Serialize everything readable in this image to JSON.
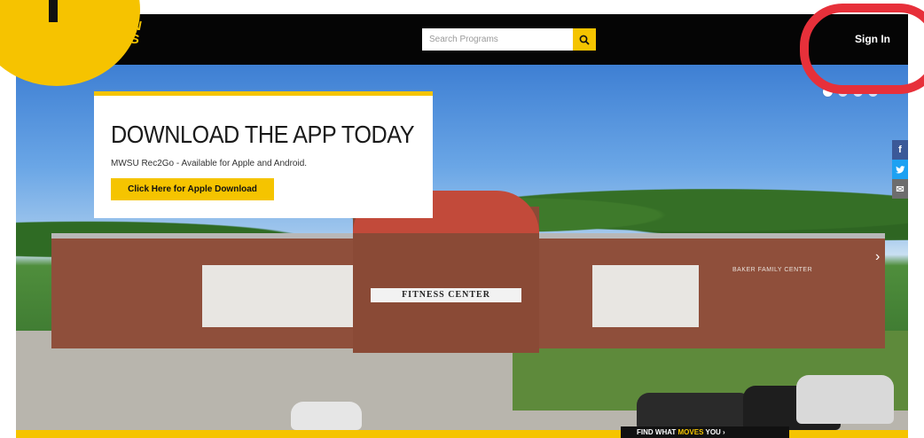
{
  "header": {
    "logo_line1": "ON",
    "logo_line2": "ES",
    "search_placeholder": "Search Programs",
    "signin_label": "Sign In"
  },
  "promo": {
    "title": "DOWNLOAD THE APP TODAY",
    "subtitle": "MWSU Rec2Go - Available for Apple and Android.",
    "button_label": "Click Here for Apple Download"
  },
  "hero": {
    "building_sign": "FITNESS CENTER",
    "building_label": "BAKER FAMILY CENTER",
    "slides": 4,
    "active_slide": 1
  },
  "share": {
    "facebook": "f",
    "twitter": "t",
    "email": "✉"
  },
  "footer_strip": {
    "find_prefix": "FIND WHAT ",
    "find_highlight": "MOVES",
    "find_suffix": " YOU ›"
  },
  "icons": {
    "search": "search-icon",
    "next": "chevron-right-icon"
  },
  "colors": {
    "accent": "#f5c400",
    "nav_bg": "#050505",
    "annotation_red": "#e7303a"
  }
}
